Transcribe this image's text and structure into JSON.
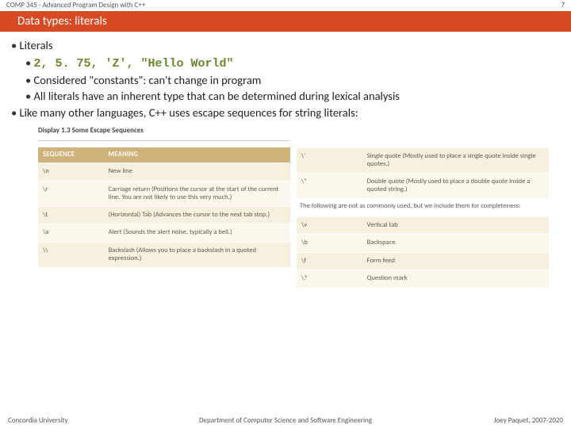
{
  "header": {
    "course": "COMP 345 - Advanced Program Design with C++",
    "page": "7"
  },
  "title": "Data types: literals",
  "content": {
    "b1a": "Literals",
    "b2a_code": "2, 5. 75, 'Z', \"Hello World\"",
    "b2b": "Considered \"constants\": can't change in program",
    "b2c": "All literals have an inherent type that can be determined during lexical analysis",
    "b1b": "Like many other languages, C++ uses escape sequences for string literals:"
  },
  "table_left": {
    "caption": "Display 1.3   Some Escape Sequences",
    "head": {
      "c1": "SEQUENCE",
      "c2": "MEANING"
    },
    "rows": [
      {
        "seq": "\\n",
        "desc": "New line"
      },
      {
        "seq": "\\r",
        "desc": "Carriage return (Positions the cursor at the start of the current line. You are not likely to use this very much.)"
      },
      {
        "seq": "\\t",
        "desc": "(Horizontal) Tab (Advances the cursor to the next tab stop.)"
      },
      {
        "seq": "\\a",
        "desc": "Alert (Sounds the alert noise, typically a bell.)"
      },
      {
        "seq": "\\\\",
        "desc": "Backslash (Allows you to place a backslash in a quoted expression.)"
      }
    ]
  },
  "table_right": {
    "rows_top": [
      {
        "seq": "\\'",
        "desc": "Single quote (Mostly used to place a single quote inside single quotes.)"
      },
      {
        "seq": "\\\"",
        "desc": "Double quote (Mostly used to place a double quote inside a quoted string.)"
      }
    ],
    "note": "The following are not as commonly used, but we include them for completeness:",
    "rows_bottom": [
      {
        "seq": "\\v",
        "desc": "Vertical tab"
      },
      {
        "seq": "\\b",
        "desc": "Backspace"
      },
      {
        "seq": "\\f",
        "desc": "Form feed"
      },
      {
        "seq": "\\?",
        "desc": "Question mark"
      }
    ]
  },
  "footer": {
    "left": "Concordia University",
    "mid": "Department of Computer Science and Software Engineering",
    "right": "Joey Paquet, 2007-2020"
  }
}
